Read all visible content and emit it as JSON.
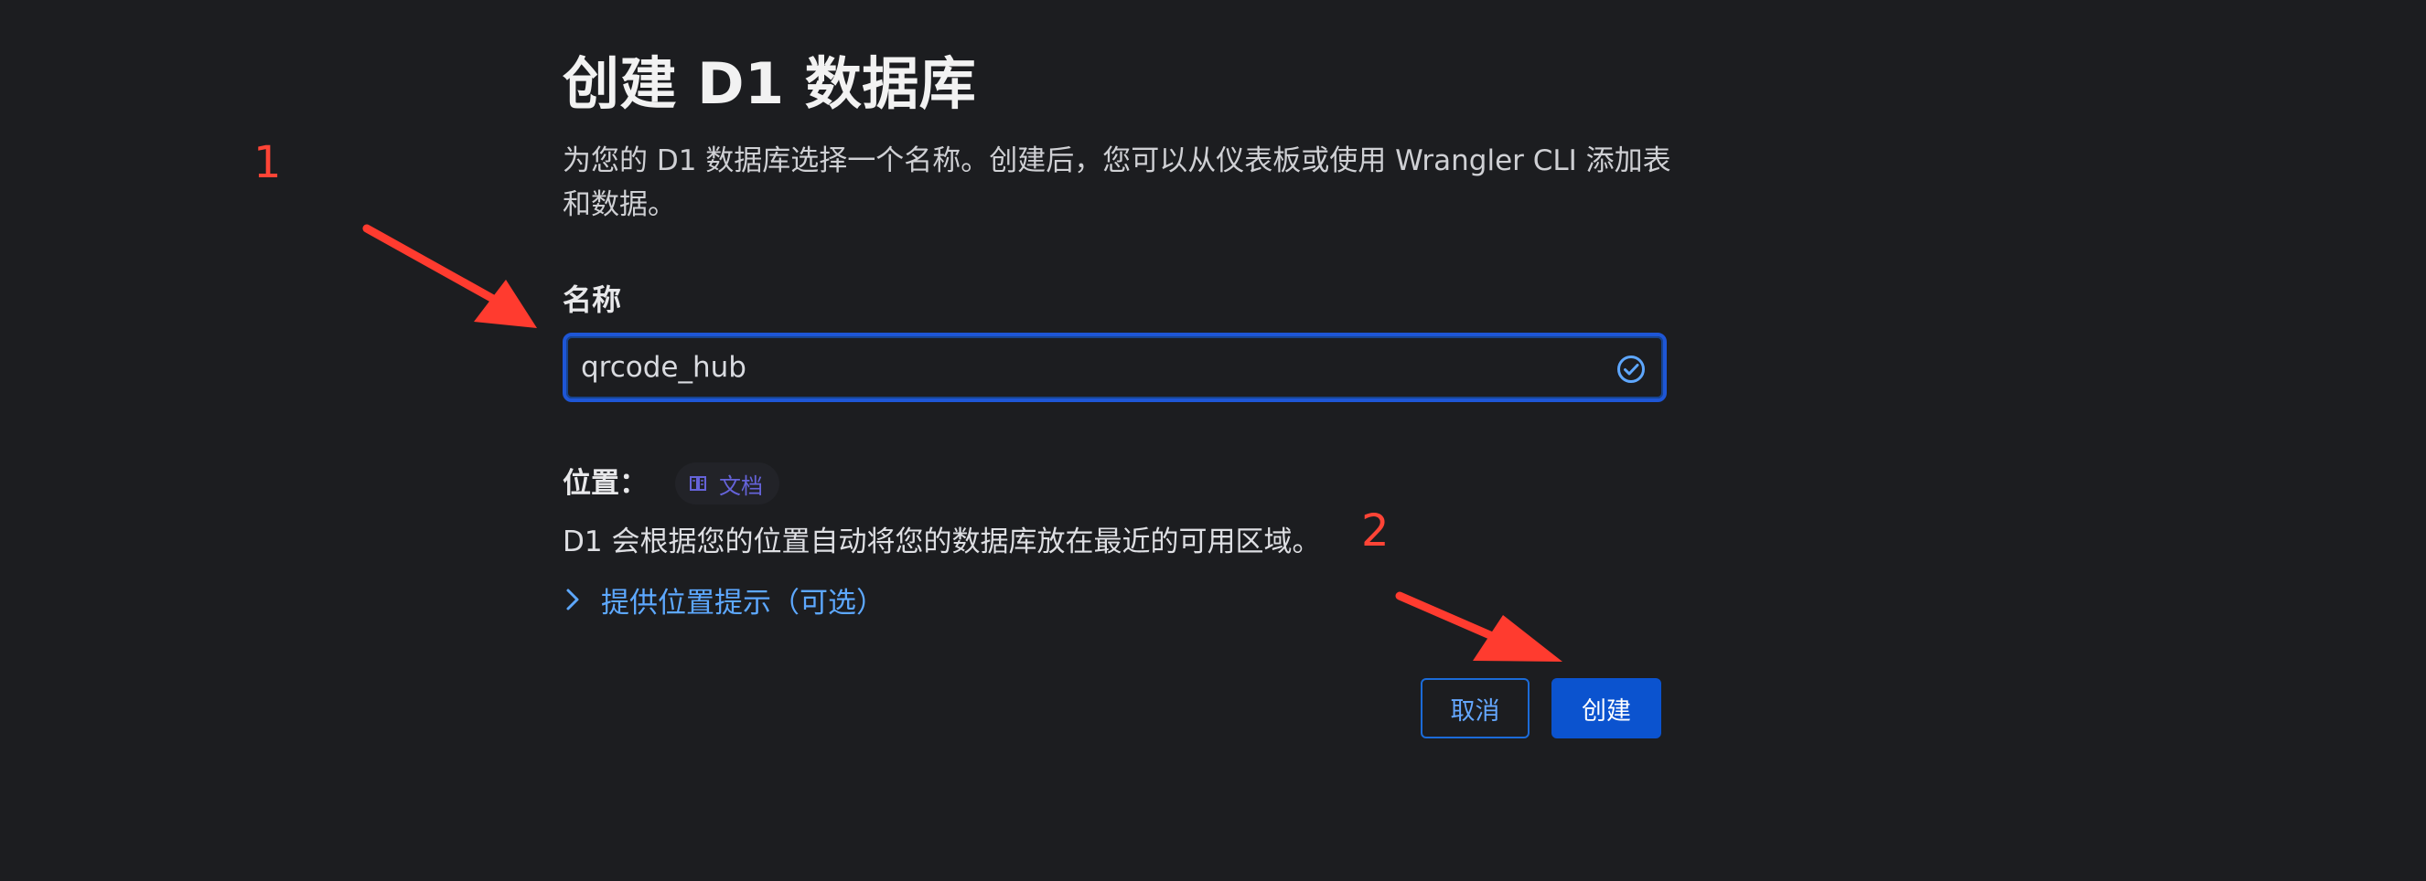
{
  "dialog": {
    "title": "创建 D1 数据库",
    "description": "为您的 D1 数据库选择一个名称。创建后，您可以从仪表板或使用 Wrangler CLI 添加表和数据。",
    "name_label": "名称",
    "name_value": "qrcode_hub",
    "location_label": "位置：",
    "docs_link": "文档",
    "location_description": "D1 会根据您的位置自动将您的数据库放在最近的可用区域。",
    "location_hint_toggle": "提供位置提示（可选）",
    "cancel_label": "取消",
    "create_label": "创建"
  },
  "annotations": {
    "step_1": "1",
    "step_2": "2"
  },
  "icons": {
    "input_status": "check-circle-icon",
    "docs": "book-icon",
    "hint_toggle": "chevron-right-icon",
    "annotation_1": "red-arrow-icon",
    "annotation_2": "red-arrow-icon"
  },
  "colors": {
    "background": "#1c1d20",
    "accent": "#0b53cf",
    "link": "#5da8ff",
    "annotation": "#ff4436"
  }
}
